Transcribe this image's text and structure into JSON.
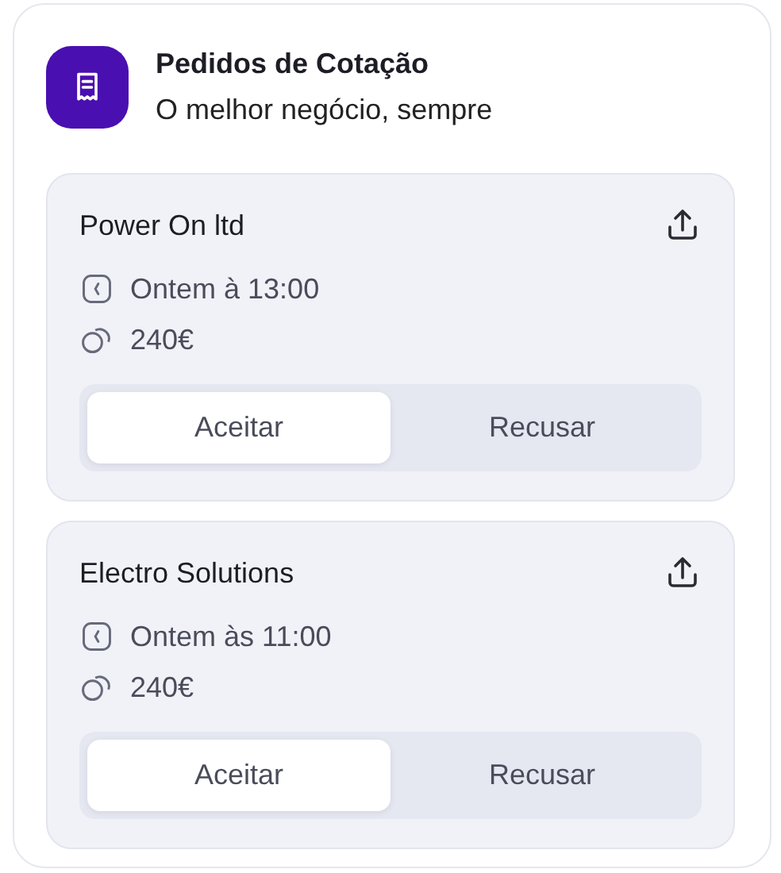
{
  "header": {
    "title": "Pedidos de Cotação",
    "subtitle": "O melhor negócio, sempre"
  },
  "quotes": [
    {
      "company": "Power On ltd",
      "time": "Ontem à 13:00",
      "price": "240€",
      "options": [
        {
          "label": "Aceitar",
          "selected": true
        },
        {
          "label": "Recusar",
          "selected": false
        }
      ]
    },
    {
      "company": "Electro Solutions",
      "time": "Ontem às 11:00",
      "price": "240€",
      "options": [
        {
          "label": "Aceitar",
          "selected": true
        },
        {
          "label": "Recusar",
          "selected": false
        }
      ]
    }
  ]
}
